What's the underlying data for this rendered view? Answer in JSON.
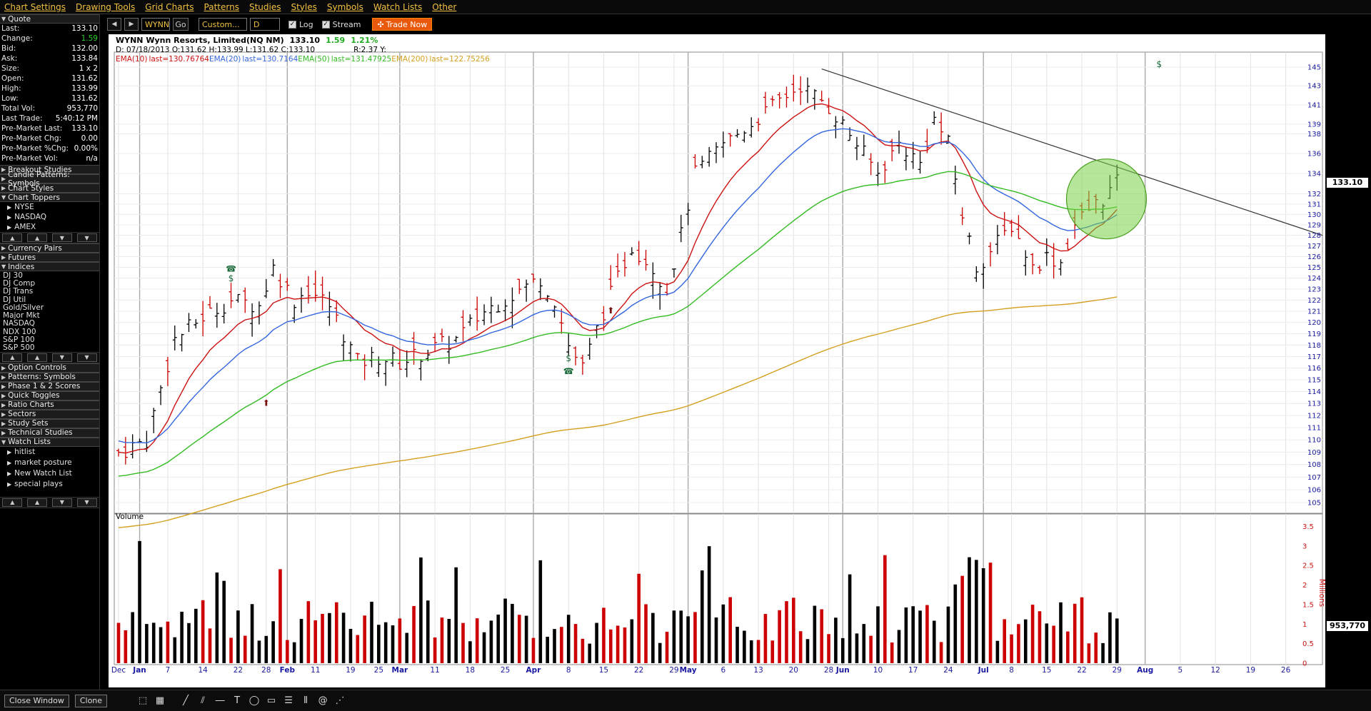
{
  "menu": [
    "Chart Settings",
    "Drawing Tools",
    "Grid Charts",
    "Patterns",
    "Studies",
    "Styles",
    "Symbols",
    "Watch Lists",
    "Other"
  ],
  "sidebar": {
    "quote_header": "Quote",
    "quote": [
      {
        "k": "Last:",
        "v": "133.10"
      },
      {
        "k": "Change:",
        "v": "1.59",
        "up": true
      },
      {
        "k": "Bid:",
        "v": "132.00"
      },
      {
        "k": "Ask:",
        "v": "133.84"
      },
      {
        "k": "Size:",
        "v": "1 x 2"
      },
      {
        "k": "Open:",
        "v": "131.62"
      },
      {
        "k": "High:",
        "v": "133.99"
      },
      {
        "k": "Low:",
        "v": "131.62"
      },
      {
        "k": "Total Vol:",
        "v": "953,770"
      },
      {
        "k": "Last Trade:",
        "v": "5:40:12 PM"
      },
      {
        "k": "Pre-Market Last:",
        "v": "133.10"
      },
      {
        "k": "Pre-Market Chg:",
        "v": "0.00"
      },
      {
        "k": "Pre-Market %Chg:",
        "v": "0.00%"
      },
      {
        "k": "Pre-Market Vol:",
        "v": "n/a"
      }
    ],
    "sections1": [
      "Breakout Studies",
      "Candle Patterns: Symbols",
      "Chart Styles",
      "Chart Toppers"
    ],
    "toppers": [
      "NYSE",
      "NASDAQ",
      "AMEX"
    ],
    "sections2": [
      "Currency Pairs",
      "Futures",
      "Indices"
    ],
    "indices": [
      "DJ 30",
      "DJ Comp",
      "DJ Trans",
      "DJ Util",
      "Gold/Silver",
      "Major Mkt",
      "NASDAQ",
      "NDX 100",
      "S&P 100",
      "S&P 500"
    ],
    "sections3": [
      "Option Controls",
      "Patterns: Symbols",
      "Phase 1 & 2 Scores",
      "Quick Toggles",
      "Ratio Charts",
      "Sectors",
      "Study Sets",
      "Technical Studies",
      "Watch Lists"
    ],
    "watchlists": [
      "hitlist",
      "market posture",
      "New Watch List",
      "special plays"
    ]
  },
  "toolbar": {
    "prev": "◀",
    "next": "▶",
    "symbol": "WYNN",
    "go": "Go",
    "range": "Custom...",
    "period": "D",
    "log_label": "Log",
    "stream_label": "Stream",
    "trade_now": "Trade Now"
  },
  "chart": {
    "header_line1": "WYNN Wynn Resorts, Limited(NQ NM)",
    "header_price": "133.10",
    "header_change": "1.59",
    "header_pct": "1.21%",
    "header_line2": "D: 07/18/2013 O:131.62 H:133.99 L:131.62 C:133.10",
    "header_r": "R:2.37 Y:",
    "ema10": "EMA(10)",
    "ema10_last": "last=130.76764",
    "ema20": "EMA(20)",
    "ema20_last": "last=130.7164",
    "ema50": "EMA(50)",
    "ema50_last": "last=131.47925",
    "ema200": "EMA(200)",
    "ema200_last": "last=122.75256",
    "volume_label": "Volume",
    "volume_unit": "Millions",
    "last_price_tag": "133.10",
    "last_volume_tag": "953,770",
    "colors": {
      "ema10": "#cc1111",
      "ema20": "#3366dd",
      "ema50": "#33bb22",
      "ema200": "#d4a020",
      "trend": "#333333"
    }
  },
  "chart_data": {
    "type": "bar",
    "price_ticks": [
      105,
      106,
      107,
      108,
      109,
      110,
      111,
      112,
      113,
      114,
      115,
      116,
      117,
      118,
      119,
      120,
      121,
      122,
      123,
      124,
      125,
      126,
      127,
      128,
      129,
      130,
      131,
      132,
      134,
      136,
      138,
      139,
      141,
      143,
      145
    ],
    "volume_ticks": [
      "0",
      "0.5",
      "1",
      "1.5",
      "2",
      "2.5",
      "3",
      "3.5"
    ],
    "x_labels": [
      "Dec",
      "Jan",
      "7",
      "14",
      "22",
      "28",
      "Feb",
      "11",
      "19",
      "25",
      "Mar",
      "11",
      "18",
      "25",
      "Apr",
      "8",
      "15",
      "22",
      "29",
      "May",
      "6",
      "13",
      "20",
      "28",
      "Jun",
      "10",
      "17",
      "24",
      "Jul",
      "8",
      "15",
      "22",
      "29",
      "Aug",
      "5",
      "12",
      "19",
      "26"
    ],
    "ylim": [
      104.5,
      146
    ],
    "volume_ylim": [
      0,
      3.6
    ],
    "log_scale": true
  },
  "bottom": {
    "close_window": "Close Window",
    "clone": "Clone"
  }
}
